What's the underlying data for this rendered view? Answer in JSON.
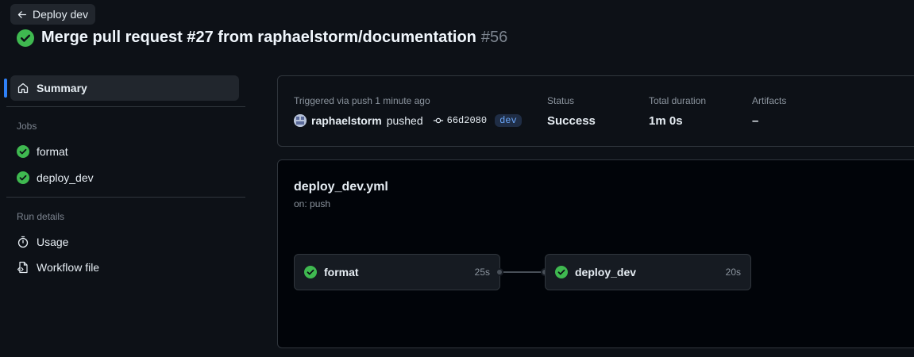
{
  "header": {
    "back_label": "Deploy dev",
    "title": "Merge pull request #27 from raphaelstorm/documentation",
    "run_number": "#56"
  },
  "sidebar": {
    "summary_label": "Summary",
    "jobs_heading": "Jobs",
    "jobs": [
      {
        "label": "format",
        "status": "success"
      },
      {
        "label": "deploy_dev",
        "status": "success"
      }
    ],
    "run_details_heading": "Run details",
    "run_details": [
      {
        "label": "Usage",
        "icon": "stopwatch-icon"
      },
      {
        "label": "Workflow file",
        "icon": "file-code-icon"
      }
    ]
  },
  "summary": {
    "triggered_text": "Triggered via push 1 minute ago",
    "user": "raphaelstorm",
    "action": "pushed",
    "commit": "66d2080",
    "branch": "dev",
    "status_label": "Status",
    "status_value": "Success",
    "duration_label": "Total duration",
    "duration_value": "1m 0s",
    "artifacts_label": "Artifacts",
    "artifacts_value": "–"
  },
  "workflow": {
    "file": "deploy_dev.yml",
    "trigger": "on: push",
    "jobs": [
      {
        "name": "format",
        "duration": "25s"
      },
      {
        "name": "deploy_dev",
        "duration": "20s"
      }
    ]
  },
  "colors": {
    "success": "#3fb950",
    "accent": "#2f81f7",
    "background": "#0d1117"
  }
}
